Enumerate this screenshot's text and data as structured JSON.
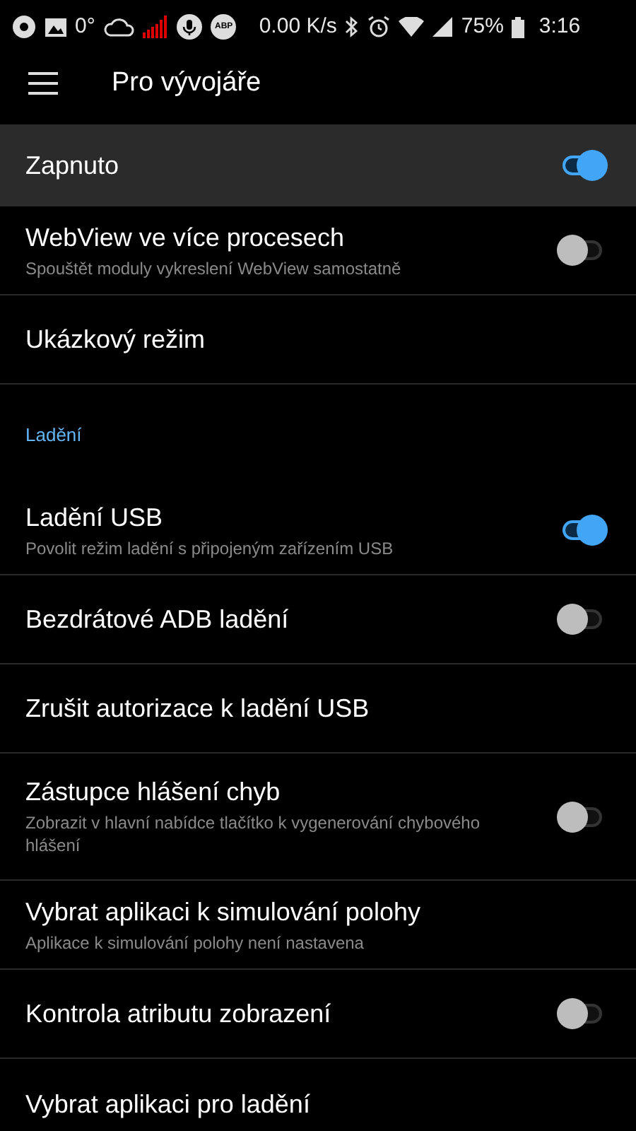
{
  "status_bar": {
    "temperature": "0°",
    "badge": "ABP",
    "speed": "0.00 K/s",
    "battery": "75%",
    "time": "3:16"
  },
  "toolbar": {
    "title": "Pro vývojáře"
  },
  "master": {
    "label": "Zapnuto",
    "on": true
  },
  "items": [
    {
      "kind": "switch",
      "title": "WebView ve více procesech",
      "subtitle": "Spouštět moduly vykreslení WebView samostatně",
      "on": false
    },
    {
      "kind": "plain",
      "title": "Ukázkový režim"
    },
    {
      "kind": "header",
      "title": "Ladění"
    },
    {
      "kind": "switch",
      "title": "Ladění USB",
      "subtitle": "Povolit režim ladění s připojeným zařízením USB",
      "on": true
    },
    {
      "kind": "switch",
      "title": "Bezdrátové ADB ladění",
      "on": false
    },
    {
      "kind": "plain",
      "title": "Zrušit autorizace k ladění USB"
    },
    {
      "kind": "switch",
      "title": "Zástupce hlášení chyb",
      "subtitle": "Zobrazit v hlavní nabídce tlačítko k vygenerování chybového hlášení",
      "on": false
    },
    {
      "kind": "plain",
      "title": "Vybrat aplikaci k simulování polohy",
      "subtitle": "Aplikace k simulování polohy není nastavena"
    },
    {
      "kind": "switch",
      "title": "Kontrola atributu zobrazení",
      "on": false
    },
    {
      "kind": "plain",
      "title": "Vybrat aplikaci pro ladění"
    }
  ]
}
